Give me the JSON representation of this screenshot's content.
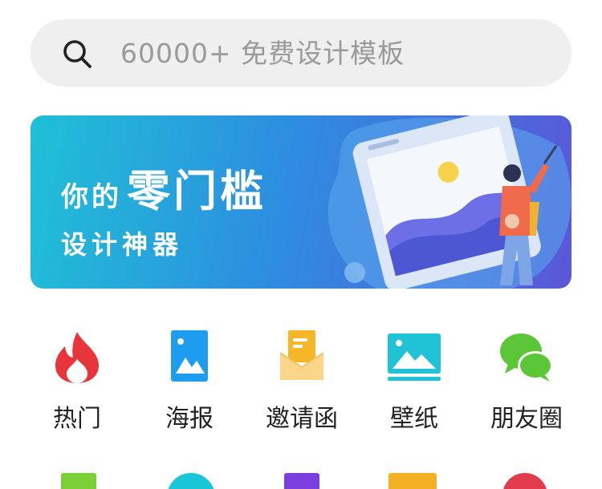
{
  "search": {
    "placeholder": "60000+ 免费设计模板",
    "icon": "search-icon"
  },
  "banner": {
    "line1_small": "你的",
    "line1_big": "零门槛",
    "line2": "设计神器"
  },
  "categories": [
    {
      "label": "热门",
      "icon": "fire-icon",
      "color": "#e8343b"
    },
    {
      "label": "海报",
      "icon": "poster-image-icon",
      "color": "#1e9df0"
    },
    {
      "label": "邀请函",
      "icon": "envelope-icon",
      "color": "#f6b628"
    },
    {
      "label": "壁纸",
      "icon": "wallpaper-landscape-icon",
      "color": "#20c3d6"
    },
    {
      "label": "朋友圈",
      "icon": "moments-chat-icon",
      "color": "#5cc639"
    }
  ],
  "row2_colors": [
    "#7bd03a",
    "#19c6d8",
    "#7b3fe0",
    "#f4b025",
    "#e23b4d"
  ]
}
